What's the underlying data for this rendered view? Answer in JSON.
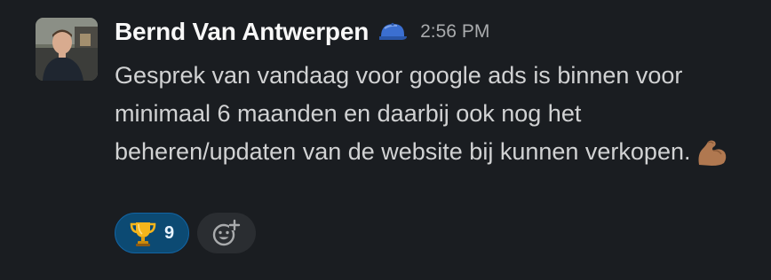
{
  "message": {
    "author": "Bernd Van Antwerpen",
    "status_icon": "blue-cap-emoji",
    "timestamp": "2:56 PM",
    "text": "Gesprek van vandaag voor google ads is binnen voor minimaal 6 maanden en daarbij ook nog het beheren/updaten van de website bij kunnen verkopen.",
    "trailing_emoji": "flexed-biceps-emoji"
  },
  "reactions": [
    {
      "emoji": "trophy-emoji",
      "count": "9"
    }
  ],
  "add_reaction": {
    "icon": "add-reaction-icon"
  },
  "colors": {
    "background": "#1a1d21",
    "author": "#f8f8f8",
    "timestamp": "#a9abad",
    "text": "#d1d2d3",
    "reaction_bg": "#0c4a73",
    "reaction_border": "#1264a3",
    "add_reaction_bg": "#2a2d31"
  }
}
